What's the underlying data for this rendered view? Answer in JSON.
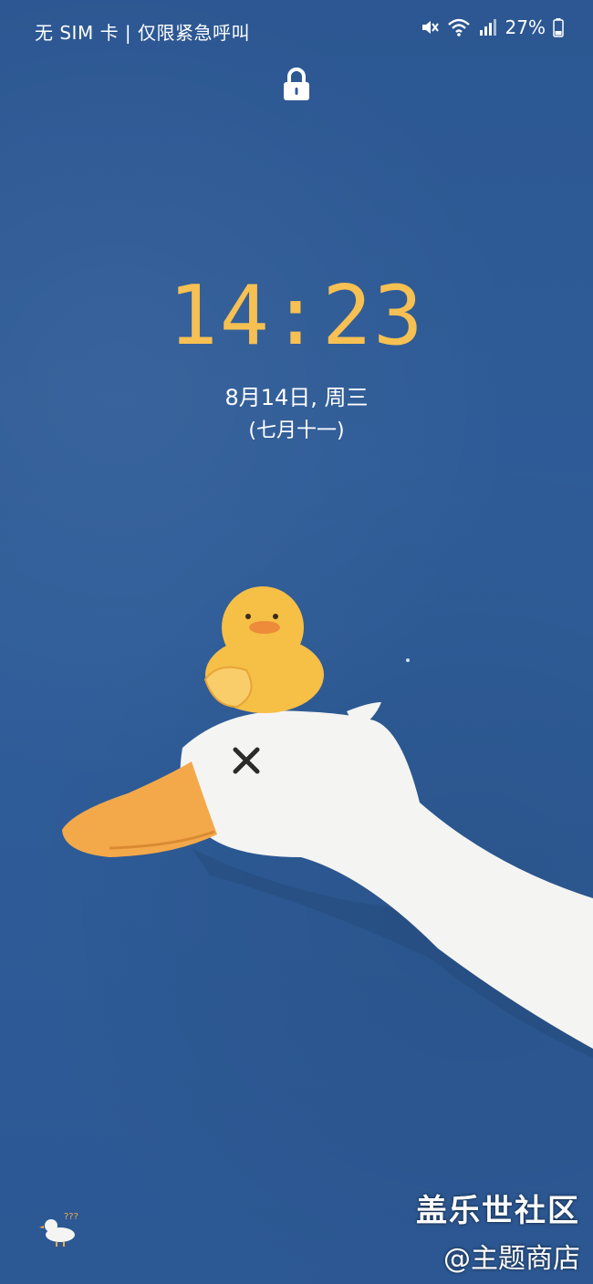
{
  "status_bar": {
    "carrier": "无 SIM 卡 | 仅限紧急呼叫",
    "battery": "27%",
    "icons": [
      "mute-icon",
      "wifi-icon",
      "signal-icon",
      "battery-icon"
    ]
  },
  "lock": {
    "icon": "lock-icon"
  },
  "clock": {
    "time": "14:23",
    "color": "#f6c052"
  },
  "date": {
    "line1": "8月14日, 周三",
    "lunar": "(七月十一)"
  },
  "watermark": {
    "line1": "盖乐世社区",
    "line2": "@主题商店"
  },
  "wallpaper": {
    "background": "#2f5c98",
    "subjects": [
      "goose",
      "rubber-duck"
    ]
  }
}
